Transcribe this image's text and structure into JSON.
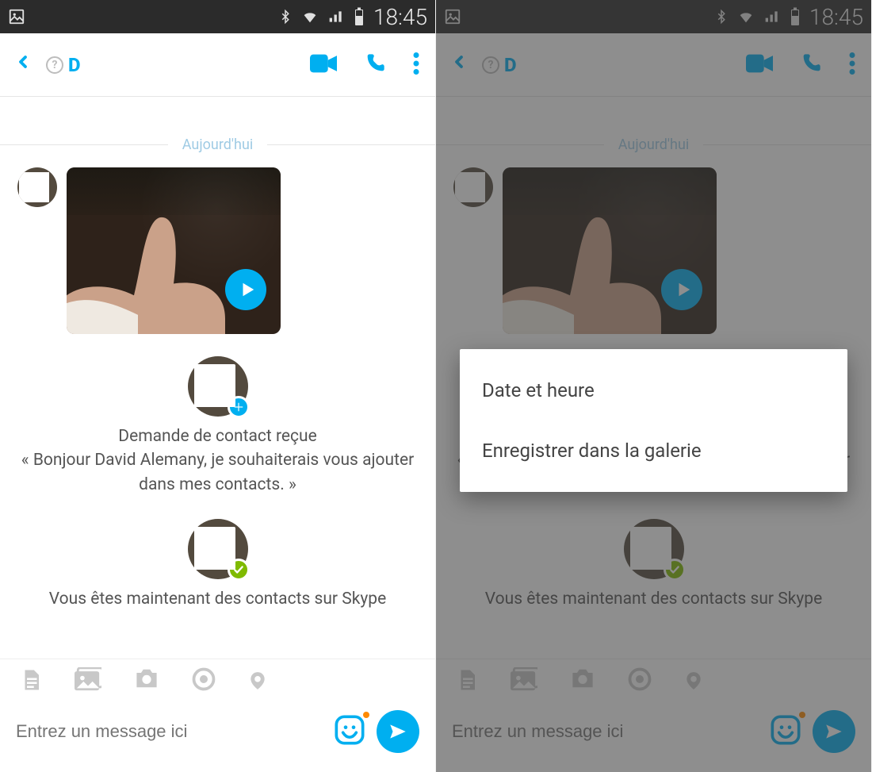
{
  "status": {
    "time": "18:45"
  },
  "header": {
    "contact_letter": "D"
  },
  "chat": {
    "day_label": "Aujourd'hui",
    "request_title": "Demande de contact reçue",
    "request_body": "« Bonjour David Alemany, je souhaiterais vous ajouter dans mes contacts. »",
    "now_contacts": "Vous êtes maintenant des contacts sur Skype"
  },
  "compose": {
    "placeholder": "Entrez un message ici"
  },
  "popup": {
    "item1": "Date et heure",
    "item2": "Enregistrer dans la galerie"
  }
}
